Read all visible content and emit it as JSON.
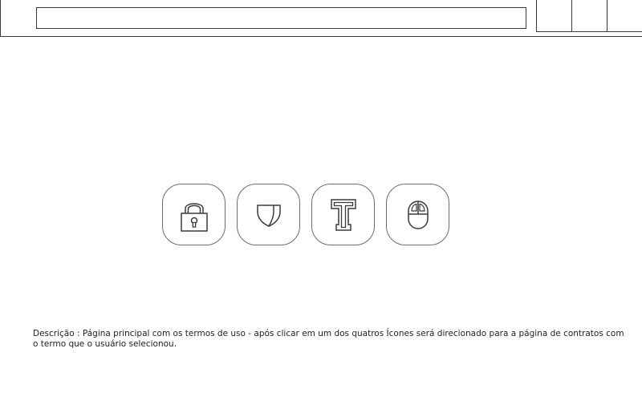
{
  "header": {
    "address_bar_value": ""
  },
  "icons": [
    {
      "name": "lock-icon"
    },
    {
      "name": "shield-icon"
    },
    {
      "name": "t-letter-icon"
    },
    {
      "name": "mouse-icon"
    }
  ],
  "description": "Descrição : Página principal com os termos de uso - após clicar em um dos quatros Ícones será direcionado para a página de contratos com o termo que o usuário selecionou."
}
